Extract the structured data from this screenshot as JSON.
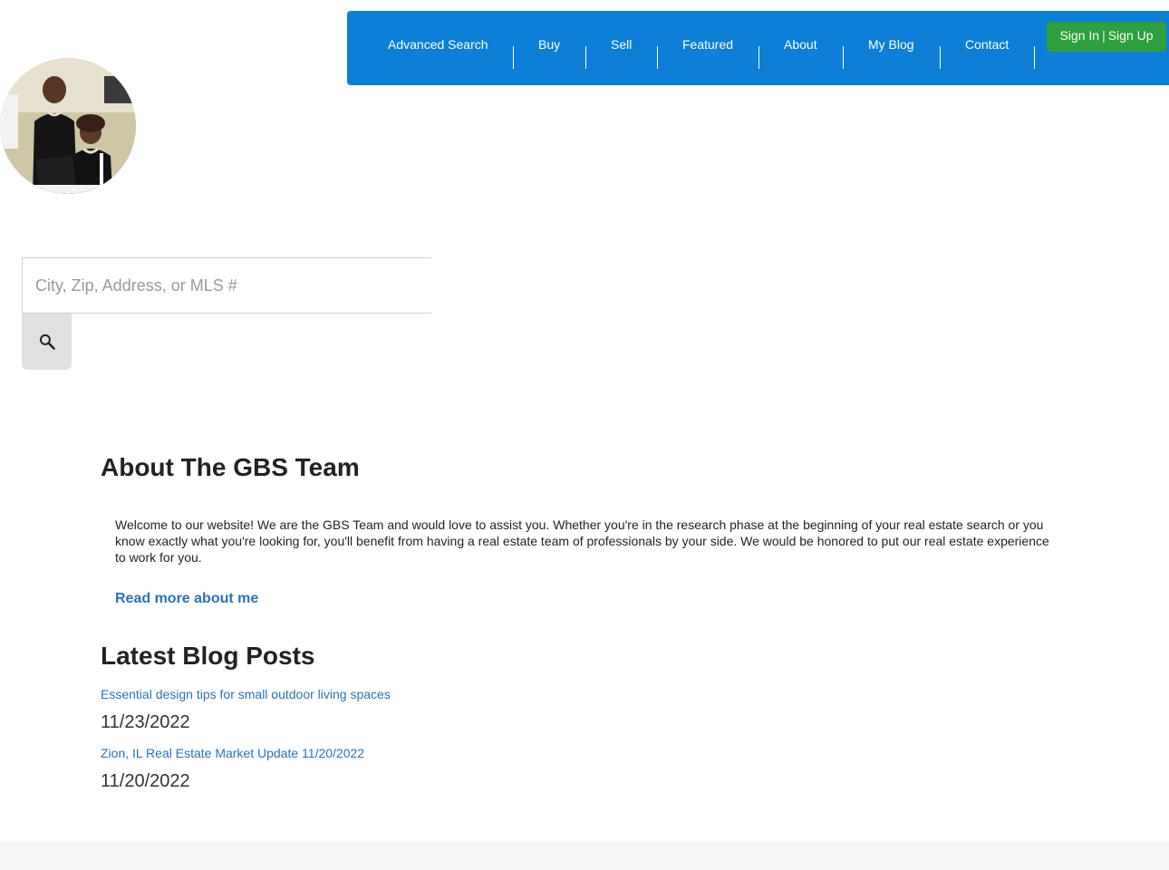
{
  "nav": {
    "items": [
      {
        "label": "Advanced Search"
      },
      {
        "label": "Buy"
      },
      {
        "label": "Sell"
      },
      {
        "label": "Featured"
      },
      {
        "label": "About"
      },
      {
        "label": "My Blog"
      },
      {
        "label": "Contact"
      }
    ],
    "sign_in": "Sign In",
    "divider": "|",
    "sign_up": "Sign Up"
  },
  "search": {
    "placeholder": "City, Zip, Address, or MLS #",
    "icon": "search-icon"
  },
  "about": {
    "title": "About The GBS Team",
    "text": "Welcome to our website! We are the GBS Team and would love to assist you. Whether you're in the research phase at the beginning of your real estate search or you know exactly what you're looking for, you'll benefit from having a real estate team of professionals by your side. We would be honored to put our real estate experience to work for you.",
    "read_more": "Read more about me"
  },
  "blog": {
    "title": "Latest Blog Posts",
    "posts": [
      {
        "title": "Essential design tips for small outdoor living spaces",
        "date": "11/23/2022"
      },
      {
        "title": "Zion, IL Real Estate Market Update 11/20/2022",
        "date": "11/20/2022"
      }
    ]
  },
  "colors": {
    "nav_bg": "#0d7fd6",
    "signin_bg": "#2e9e3e",
    "link": "#2b73b4"
  }
}
